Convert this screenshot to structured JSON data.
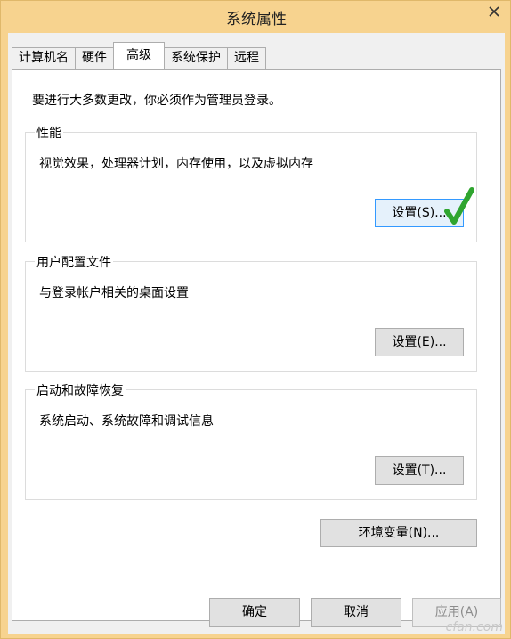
{
  "window": {
    "title": "系统属性"
  },
  "tabs": [
    {
      "label": "计算机名"
    },
    {
      "label": "硬件"
    },
    {
      "label": "高级"
    },
    {
      "label": "系统保护"
    },
    {
      "label": "远程"
    }
  ],
  "panel": {
    "notice": "要进行大多数更改，你必须作为管理员登录。",
    "groups": [
      {
        "title": "性能",
        "description": "视觉效果，处理器计划，内存使用，以及虚拟内存",
        "button": "设置(S)..."
      },
      {
        "title": "用户配置文件",
        "description": "与登录帐户相关的桌面设置",
        "button": "设置(E)..."
      },
      {
        "title": "启动和故障恢复",
        "description": "系统启动、系统故障和调试信息",
        "button": "设置(T)..."
      }
    ],
    "env_button": "环境变量(N)..."
  },
  "footer": {
    "ok": "确定",
    "cancel": "取消",
    "apply": "应用(A)"
  },
  "watermark": "cfan.com",
  "colors": {
    "titlebar": "#F7D38F",
    "checkmark": "#2FA52F",
    "close": "#333333"
  }
}
